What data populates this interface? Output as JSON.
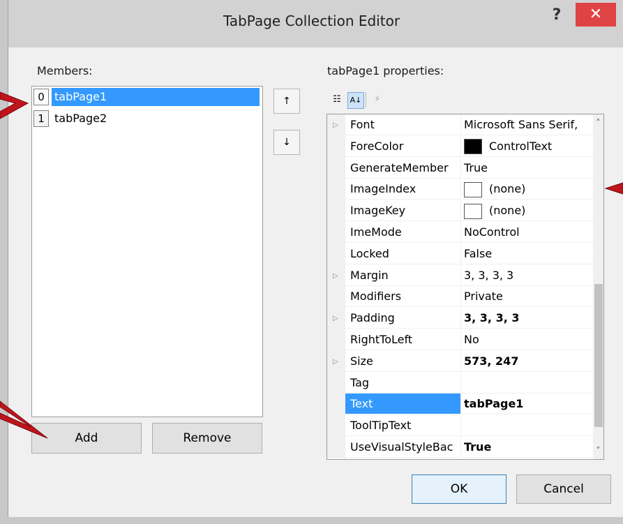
{
  "window": {
    "title": "TabPage Collection Editor",
    "help_label": "?",
    "close_label": "✕"
  },
  "members": {
    "label": "Members:",
    "items": [
      {
        "index": "0",
        "name": "tabPage1",
        "selected": true
      },
      {
        "index": "1",
        "name": "tabPage2",
        "selected": false
      }
    ],
    "move_up_icon": "↑",
    "move_down_icon": "↓",
    "add_label": "Add",
    "remove_label": "Remove"
  },
  "properties": {
    "label": "tabPage1 properties:",
    "toolbar": {
      "categorized_icon": "☷",
      "alphabetical_icon": "A↓",
      "events_icon": "⚡"
    },
    "rows": [
      {
        "name": "Font",
        "value": "Microsoft Sans Serif,",
        "expandable": true
      },
      {
        "name": "ForeColor",
        "value": "ControlText",
        "swatch": "black"
      },
      {
        "name": "GenerateMember",
        "value": "True"
      },
      {
        "name": "ImageIndex",
        "value": "(none)",
        "swatch": "white"
      },
      {
        "name": "ImageKey",
        "value": "(none)",
        "swatch": "white"
      },
      {
        "name": "ImeMode",
        "value": "NoControl"
      },
      {
        "name": "Locked",
        "value": "False"
      },
      {
        "name": "Margin",
        "value": "3, 3, 3, 3",
        "expandable": true
      },
      {
        "name": "Modifiers",
        "value": "Private"
      },
      {
        "name": "Padding",
        "value": "3, 3, 3, 3",
        "expandable": true,
        "bold": true
      },
      {
        "name": "RightToLeft",
        "value": "No"
      },
      {
        "name": "Size",
        "value": "573, 247",
        "expandable": true,
        "bold": true
      },
      {
        "name": "Tag",
        "value": ""
      },
      {
        "name": "Text",
        "value": "tabPage1",
        "bold": true,
        "selected": true
      },
      {
        "name": "ToolTipText",
        "value": ""
      },
      {
        "name": "UseVisualStyleBac",
        "value": "True",
        "bold": true
      }
    ],
    "expand_glyph": "▷",
    "scroll_up": "˄",
    "scroll_down": "˅"
  },
  "footer": {
    "ok_label": "OK",
    "cancel_label": "Cancel"
  },
  "colors": {
    "selection": "#3399ff",
    "close_button": "#e04343",
    "annotation": "#c0141c"
  }
}
